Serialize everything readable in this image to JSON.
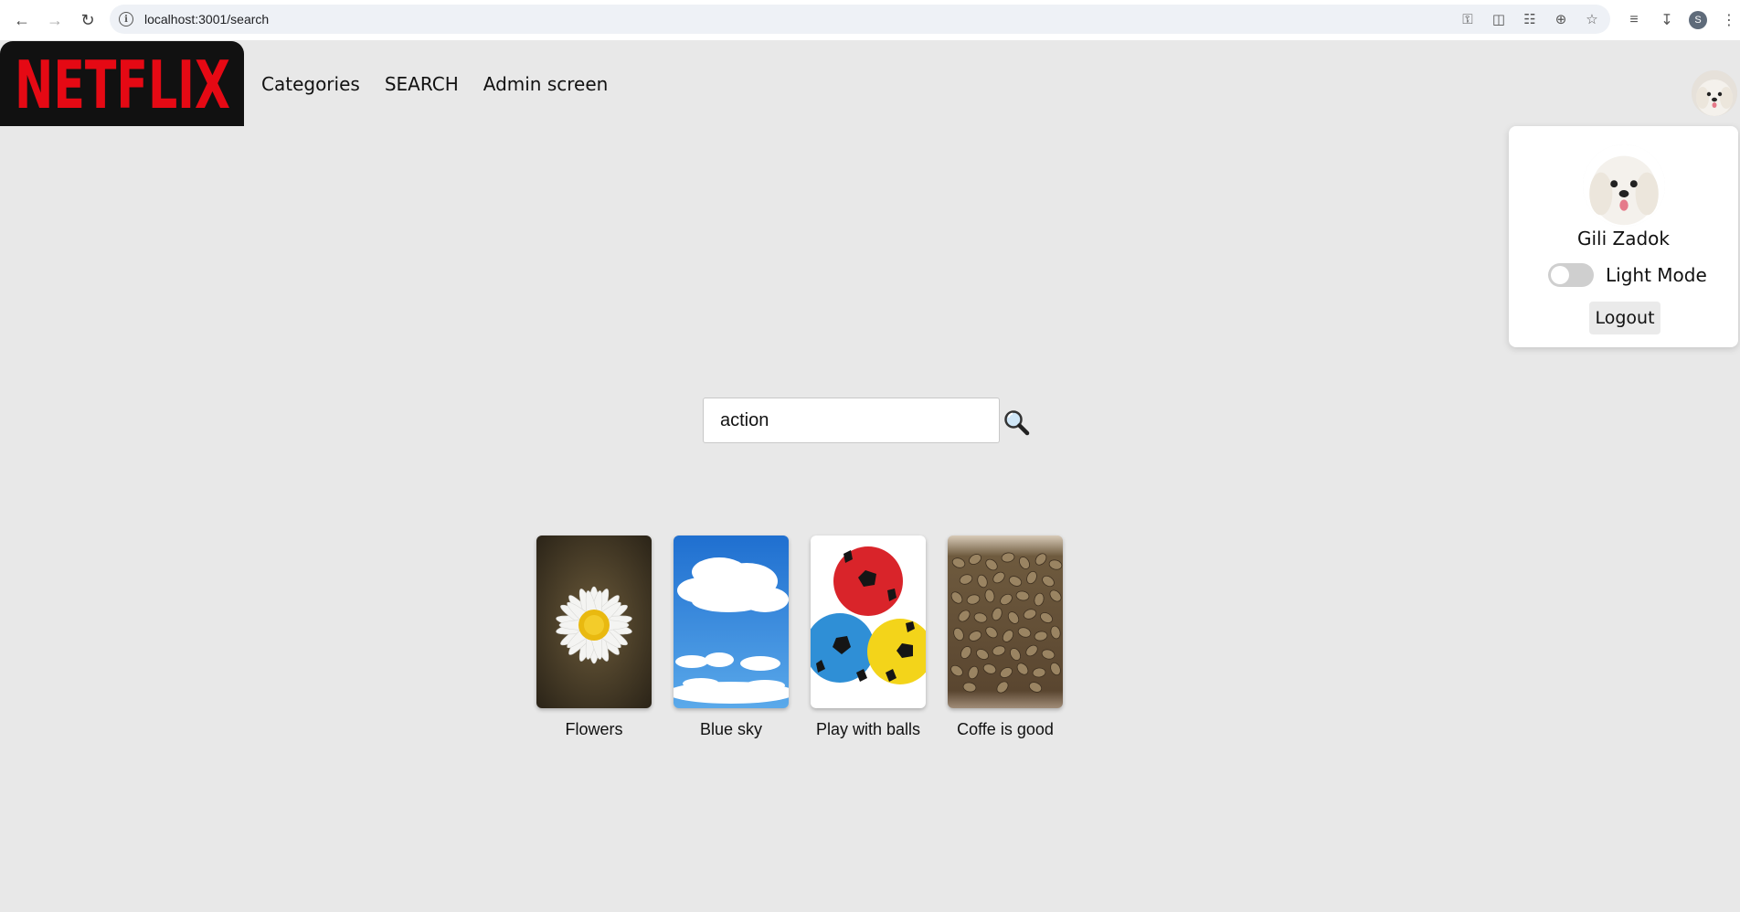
{
  "browser": {
    "url": "localhost:3001/search",
    "back_icon": "back-arrow-icon",
    "forward_icon": "forward-arrow-icon",
    "reload_icon": "reload-icon",
    "profile_initial": "S"
  },
  "header": {
    "logo_text": "NETFLIX",
    "nav": [
      {
        "label": "Categories"
      },
      {
        "label": "SEARCH"
      },
      {
        "label": "Admin screen"
      }
    ]
  },
  "profile_menu": {
    "user_name": "Gili Zadok",
    "mode_label": "Light Mode",
    "dark_mode_on": false,
    "logout_label": "Logout"
  },
  "search": {
    "value": "action"
  },
  "results": [
    {
      "title": "Flowers"
    },
    {
      "title": "Blue sky"
    },
    {
      "title": "Play with balls"
    },
    {
      "title": "Coffe is good"
    }
  ],
  "colors": {
    "brand_red": "#e50914",
    "background": "#e8e8e8"
  }
}
